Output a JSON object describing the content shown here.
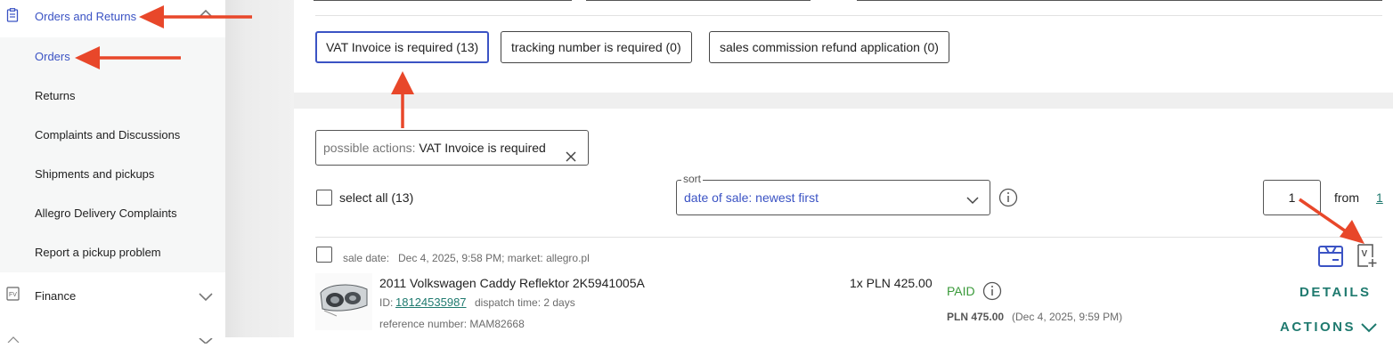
{
  "sidebar": {
    "section_title": "Orders and Returns",
    "items": [
      {
        "label": "Orders"
      },
      {
        "label": "Returns"
      },
      {
        "label": "Complaints and Discussions"
      },
      {
        "label": "Shipments and pickups"
      },
      {
        "label": "Allegro Delivery Complaints"
      },
      {
        "label": "Report a pickup problem"
      }
    ],
    "finance_label": "Finance"
  },
  "filters": {
    "chips": [
      {
        "label": "VAT Invoice is required (13)",
        "active": true
      },
      {
        "label": "tracking number is required (0)",
        "active": false
      },
      {
        "label": "sales commission refund application (0)",
        "active": false
      }
    ]
  },
  "active_filter": {
    "prefix": "possible actions:",
    "value": "VAT Invoice is required"
  },
  "list_controls": {
    "select_all": "select all (13)",
    "sort_label": "sort",
    "sort_value": "date of sale: newest first",
    "page_current": "1",
    "page_from": "from",
    "page_total": "1"
  },
  "order": {
    "sale_date_label": "sale date:",
    "sale_date_value": "Dec 4, 2025, 9:58 PM; market: allegro.pl",
    "title": "2011 Volkswagen Caddy Reflektor 2K5941005A",
    "id_label": "ID:",
    "id_value": "18124535987",
    "dispatch": "dispatch time: 2 days",
    "reference": "reference number: MAM82668",
    "quantity_price": "1x PLN 425.00",
    "status": "PAID",
    "total": "PLN 475.00",
    "paid_date": "(Dec 4, 2025, 9:59 PM)",
    "details_label": "DETAILS",
    "actions_label": "ACTIONS"
  },
  "colors": {
    "accent_blue": "#3b53c4",
    "teal": "#1f7a6f",
    "paid_green": "#3a9a3a",
    "annotation_arrow": "#e8472a"
  }
}
